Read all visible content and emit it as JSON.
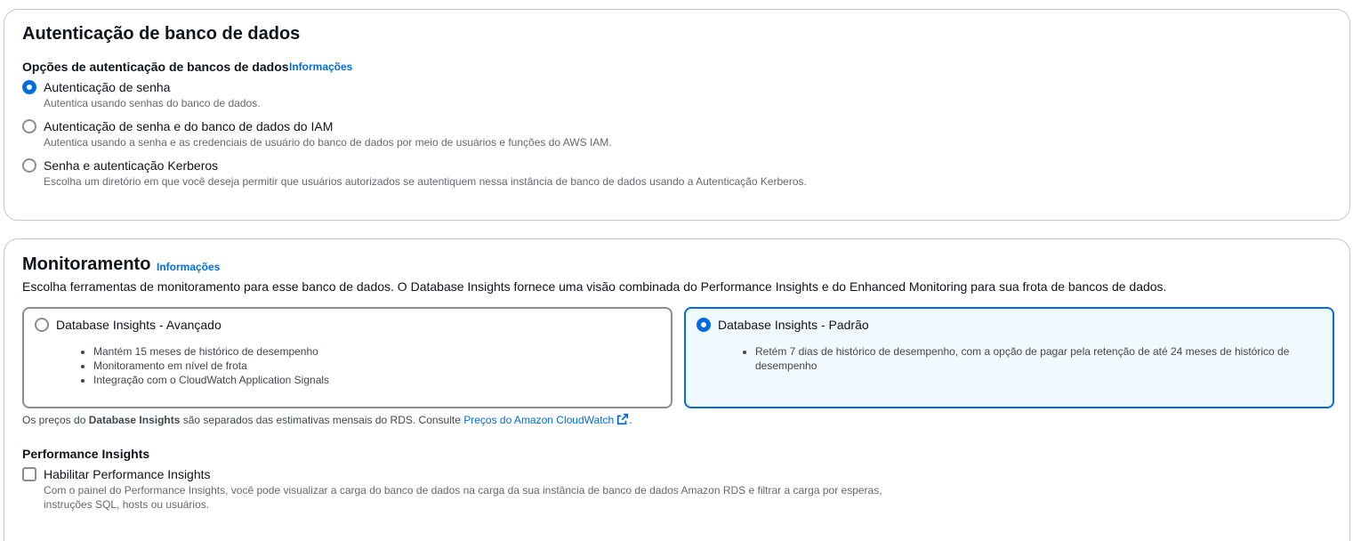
{
  "auth": {
    "title": "Autenticação de banco de dados",
    "options_label": "Opções de autenticação de bancos de dados",
    "info_link": "Informações",
    "options": [
      {
        "label": "Autenticação de senha",
        "description": "Autentica usando senhas do banco de dados.",
        "selected": true
      },
      {
        "label": "Autenticação de senha e do banco de dados do IAM",
        "description": "Autentica usando a senha e as credenciais de usuário do banco de dados por meio de usuários e funções do AWS IAM.",
        "selected": false
      },
      {
        "label": "Senha e autenticação Kerberos",
        "description": "Escolha um diretório em que você deseja permitir que usuários autorizados se autentiquem nessa instância de banco de dados usando a Autenticação Kerberos.",
        "selected": false
      }
    ]
  },
  "monitoring": {
    "title": "Monitoramento",
    "info_link": "Informações",
    "description": "Escolha ferramentas de monitoramento para esse banco de dados. O Database Insights fornece uma visão combinada do Performance Insights e do Enhanced Monitoring para sua frota de bancos de dados.",
    "tiles": [
      {
        "label": "Database Insights - Avançado",
        "selected": false,
        "bullets": [
          "Mantém 15 meses de histórico de desempenho",
          "Monitoramento em nível de frota",
          "Integração com o CloudWatch Application Signals"
        ]
      },
      {
        "label": "Database Insights - Padrão",
        "selected": true,
        "bullets": [
          "Retém 7 dias de histórico de desempenho, com a opção de pagar pela retenção de até 24 meses de histórico de desempenho"
        ]
      }
    ],
    "pricing_note": {
      "prefix": "Os preços do ",
      "bold": "Database Insights",
      "middle": " são separados das estimativas mensais do RDS. Consulte ",
      "link": "Preços do Amazon CloudWatch",
      "suffix": "."
    },
    "performance_insights": {
      "heading": "Performance Insights",
      "checkbox_label": "Habilitar Performance Insights",
      "checked": false,
      "description_line1": "Com o painel do Performance Insights, você pode visualizar a carga do banco de dados na carga da sua instância de banco de dados Amazon RDS e filtrar a carga por esperas,",
      "description_line2": "instruções SQL, hosts ou usuários."
    }
  },
  "colors": {
    "accent": "#006ce0",
    "selected_tile_bg": "#f0fafe",
    "border": "#c6c6cd"
  },
  "icons": {
    "external_link": "external-link-icon"
  }
}
